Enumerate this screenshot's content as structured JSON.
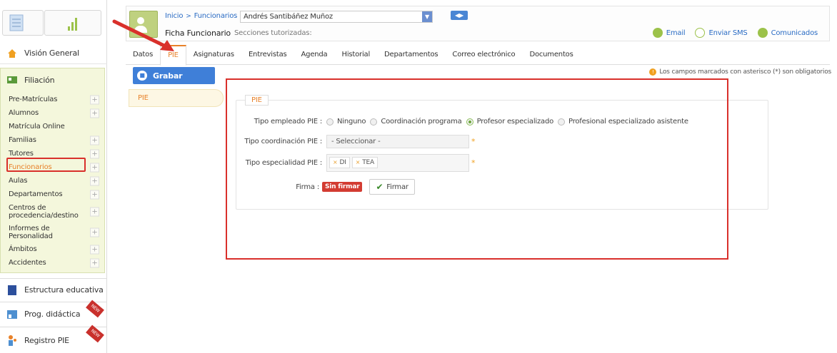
{
  "sidebar": {
    "vision_general": "Visión General",
    "filiacion": "Filiación",
    "items": [
      {
        "label": "Pre-Matrículas",
        "plus": true
      },
      {
        "label": "Alumnos",
        "plus": true
      },
      {
        "label": "Matrícula Online",
        "plus": false
      },
      {
        "label": "Familias",
        "plus": true
      },
      {
        "label": "Tutores",
        "plus": true
      },
      {
        "label": "Funcionarios",
        "plus": true
      },
      {
        "label": "Aulas",
        "plus": true
      },
      {
        "label": "Departamentos",
        "plus": true
      },
      {
        "label": "Centros de procedencia/destino",
        "plus": true
      },
      {
        "label": "Informes de Personalidad",
        "plus": true
      },
      {
        "label": "Ámbitos",
        "plus": true
      },
      {
        "label": "Accidentes",
        "plus": true
      }
    ],
    "plus_symbol": "+",
    "estructura": "Estructura educativa",
    "prog": "Prog. didáctica",
    "registro": "Registro PIE",
    "new_badge": "NEW"
  },
  "header": {
    "breadcrumb": [
      "Inicio",
      "Funcionarios"
    ],
    "breadcrumb_sep": ">",
    "person": "Andrés Santibáñez Muñoz",
    "title": "Ficha Funcionario",
    "subtitle": "Secciones tutorizadas:",
    "actions": {
      "email": "Email",
      "sms": "Enviar SMS",
      "comunicados": "Comunicados"
    }
  },
  "tabs": [
    "Datos",
    "PIE",
    "Asignaturas",
    "Entrevistas",
    "Agenda",
    "Historial",
    "Departamentos",
    "Correo electrónico",
    "Documentos"
  ],
  "active_tab": "PIE",
  "toolbar": {
    "grabar": "Grabar",
    "notice": "Los campos marcados con asterisco (*) son obligatorios"
  },
  "side_tab": "PIE",
  "form": {
    "legend": "PIE",
    "tipo_empleado_label": "Tipo empleado PIE :",
    "tipo_empleado_options": [
      "Ninguno",
      "Coordinación programa",
      "Profesor especializado",
      "Profesional especializado asistente"
    ],
    "tipo_empleado_selected": "Profesor especializado",
    "tipo_coord_label": "Tipo coordinación PIE :",
    "tipo_coord_value": "- Seleccionar -",
    "tipo_esp_label": "Tipo especialidad PIE :",
    "tipo_esp_values": [
      "DI",
      "TEA"
    ],
    "chip_remove": "×",
    "required_mark": "*",
    "firma_label": "Firma :",
    "firma_status": "Sin firmar",
    "firmar_button": "Firmar",
    "checkmark": "✔"
  },
  "colors": {
    "accent": "#e8822a",
    "link": "#2b6cc4",
    "primary_button": "#3f7fd8",
    "annotation": "#d9302b",
    "sidebar_panel": "#f4f7dc"
  }
}
